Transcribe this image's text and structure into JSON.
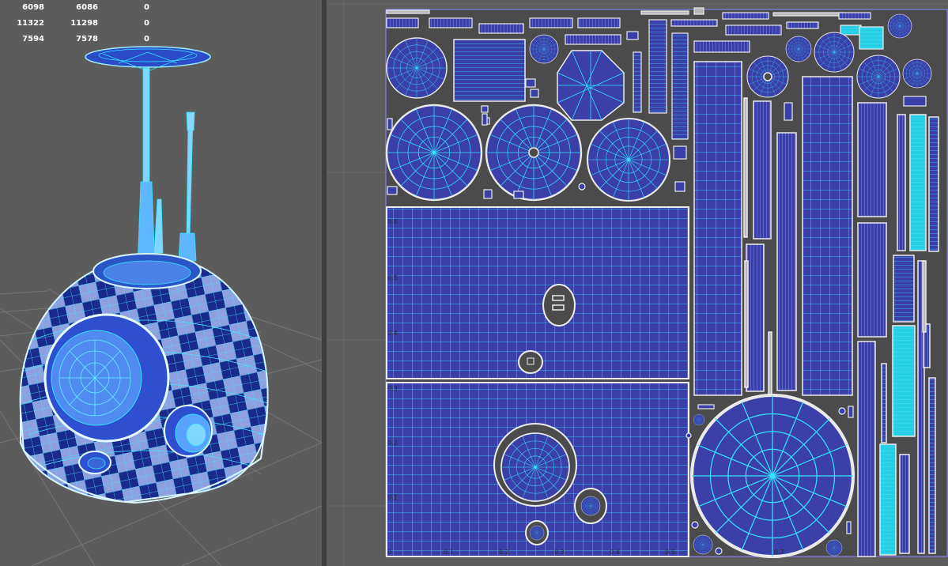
{
  "hud": {
    "rows": [
      {
        "a": "6098",
        "b": "6086",
        "c": "0"
      },
      {
        "a": "11322",
        "b": "11298",
        "c": "0"
      },
      {
        "a": "7594",
        "b": "7578",
        "c": "0"
      }
    ]
  },
  "uv_editor": {
    "grid_labels": {
      "v_06": "0.6",
      "v_05": "0.5",
      "v_04": "0.4",
      "v_03": "0.3",
      "v_02": "0.2",
      "v_01": "0.1",
      "u_0": "0",
      "u_01": "0.1",
      "u_02": "0.2",
      "u_03": "0.3",
      "u_04": "0.4",
      "u_05": "0.5",
      "u_07": "0.7"
    }
  },
  "colors": {
    "uv_fill": "#3b3fa8",
    "wire": "#35e3ff",
    "border": "#e6e6e6",
    "checker_dark": "#1a2a8c",
    "checker_light": "#8ea0e0",
    "viewport_bg": "#5c5c5c"
  }
}
